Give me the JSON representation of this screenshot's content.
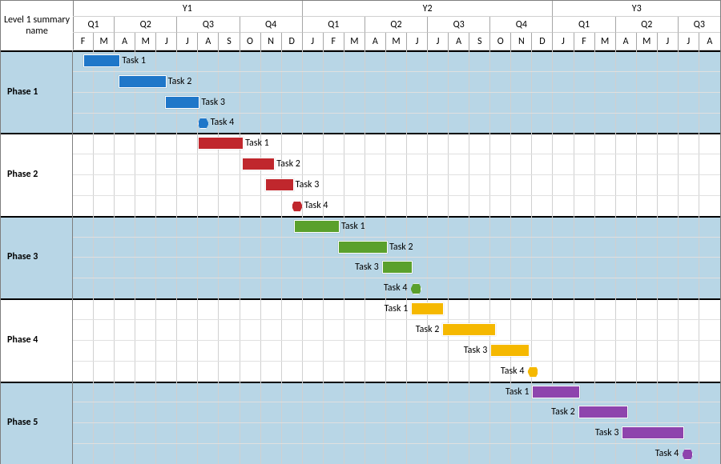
{
  "header": {
    "corner": "Level 1 summary name",
    "years": [
      "Y1",
      "Y2",
      "Y3"
    ],
    "quarters": [
      "Q1",
      "Q2",
      "Q3",
      "Q4",
      "Q1",
      "Q2",
      "Q3",
      "Q4",
      "Q1",
      "Q2",
      "Q3"
    ],
    "months": [
      "F",
      "M",
      "A",
      "M",
      "J",
      "J",
      "A",
      "S",
      "O",
      "N",
      "D",
      "J",
      "F",
      "M",
      "A",
      "M",
      "J",
      "J",
      "A",
      "S",
      "O",
      "N",
      "D",
      "J",
      "F",
      "M",
      "A",
      "M",
      "J",
      "J",
      "A"
    ]
  },
  "phases": [
    {
      "name": "Phase 1",
      "shaded": true,
      "color": "blue",
      "tasks": [
        {
          "label": "Task 1",
          "start_m": 0.5,
          "end_m": 2.2,
          "labelSide": "right"
        },
        {
          "label": "Task 2",
          "start_m": 2.2,
          "end_m": 4.4,
          "labelSide": "right"
        },
        {
          "label": "Task 3",
          "start_m": 4.4,
          "end_m": 6.0,
          "labelSide": "right"
        },
        {
          "label": "Task 4",
          "start_m": 6.2,
          "milestone": true,
          "labelSide": "right"
        }
      ]
    },
    {
      "name": "Phase 2",
      "shaded": false,
      "color": "red",
      "tasks": [
        {
          "label": "Task 1",
          "start_m": 6.0,
          "end_m": 8.1,
          "labelSide": "right"
        },
        {
          "label": "Task 2",
          "start_m": 8.1,
          "end_m": 9.6,
          "labelSide": "right"
        },
        {
          "label": "Task 3",
          "start_m": 9.2,
          "end_m": 10.5,
          "labelSide": "right"
        },
        {
          "label": "Task 4",
          "start_m": 10.7,
          "milestone": true,
          "labelSide": "right"
        }
      ]
    },
    {
      "name": "Phase 3",
      "shaded": true,
      "color": "green",
      "tasks": [
        {
          "label": "Task 1",
          "start_m": 10.6,
          "end_m": 12.7,
          "labelSide": "right"
        },
        {
          "label": "Task 2",
          "start_m": 12.7,
          "end_m": 15.0,
          "labelSide": "right"
        },
        {
          "label": "Task 3",
          "start_m": 14.8,
          "end_m": 16.2,
          "labelSide": "left"
        },
        {
          "label": "Task 4",
          "start_m": 16.4,
          "milestone": true,
          "labelSide": "left"
        }
      ]
    },
    {
      "name": "Phase 4",
      "shaded": false,
      "color": "yellow",
      "tasks": [
        {
          "label": "Task 1",
          "start_m": 16.2,
          "end_m": 17.7,
          "labelSide": "left"
        },
        {
          "label": "Task 2",
          "start_m": 17.7,
          "end_m": 20.2,
          "labelSide": "left"
        },
        {
          "label": "Task 3",
          "start_m": 20.0,
          "end_m": 21.8,
          "labelSide": "left"
        },
        {
          "label": "Task 4",
          "start_m": 22.0,
          "milestone": true,
          "labelSide": "left"
        }
      ]
    },
    {
      "name": "Phase 5",
      "shaded": true,
      "color": "purple",
      "tasks": [
        {
          "label": "Task 1",
          "start_m": 22.0,
          "end_m": 24.2,
          "labelSide": "left"
        },
        {
          "label": "Task 2",
          "start_m": 24.2,
          "end_m": 26.5,
          "labelSide": "left"
        },
        {
          "label": "Task 3",
          "start_m": 26.3,
          "end_m": 29.2,
          "labelSide": "left"
        },
        {
          "label": "Task 4",
          "start_m": 29.4,
          "milestone": true,
          "labelSide": "left"
        }
      ]
    }
  ],
  "chart_data": {
    "type": "bar",
    "title": "",
    "xlabel": "",
    "ylabel": "",
    "timeline": {
      "start": "Y1 Feb",
      "end": "Y3 Aug",
      "total_months": 31,
      "month_labels": [
        "F",
        "M",
        "A",
        "M",
        "J",
        "J",
        "A",
        "S",
        "O",
        "N",
        "D",
        "J",
        "F",
        "M",
        "A",
        "M",
        "J",
        "J",
        "A",
        "S",
        "O",
        "N",
        "D",
        "J",
        "F",
        "M",
        "A",
        "M",
        "J",
        "J",
        "A"
      ]
    },
    "series": [
      {
        "name": "Phase 1",
        "color": "#1f77c9",
        "tasks": [
          {
            "name": "Task 1",
            "start_month": 0.5,
            "end_month": 2.2
          },
          {
            "name": "Task 2",
            "start_month": 2.2,
            "end_month": 4.4
          },
          {
            "name": "Task 3",
            "start_month": 4.4,
            "end_month": 6.0
          },
          {
            "name": "Task 4",
            "milestone_month": 6.2
          }
        ]
      },
      {
        "name": "Phase 2",
        "color": "#c0272d",
        "tasks": [
          {
            "name": "Task 1",
            "start_month": 6.0,
            "end_month": 8.1
          },
          {
            "name": "Task 2",
            "start_month": 8.1,
            "end_month": 9.6
          },
          {
            "name": "Task 3",
            "start_month": 9.2,
            "end_month": 10.5
          },
          {
            "name": "Task 4",
            "milestone_month": 10.7
          }
        ]
      },
      {
        "name": "Phase 3",
        "color": "#5aa02c",
        "tasks": [
          {
            "name": "Task 1",
            "start_month": 10.6,
            "end_month": 12.7
          },
          {
            "name": "Task 2",
            "start_month": 12.7,
            "end_month": 15.0
          },
          {
            "name": "Task 3",
            "start_month": 14.8,
            "end_month": 16.2
          },
          {
            "name": "Task 4",
            "milestone_month": 16.4
          }
        ]
      },
      {
        "name": "Phase 4",
        "color": "#f5b800",
        "tasks": [
          {
            "name": "Task 1",
            "start_month": 16.2,
            "end_month": 17.7
          },
          {
            "name": "Task 2",
            "start_month": 17.7,
            "end_month": 20.2
          },
          {
            "name": "Task 3",
            "start_month": 20.0,
            "end_month": 21.8
          },
          {
            "name": "Task 4",
            "milestone_month": 22.0
          }
        ]
      },
      {
        "name": "Phase 5",
        "color": "#8e44ad",
        "tasks": [
          {
            "name": "Task 1",
            "start_month": 22.0,
            "end_month": 24.2
          },
          {
            "name": "Task 2",
            "start_month": 24.2,
            "end_month": 26.5
          },
          {
            "name": "Task 3",
            "start_month": 26.3,
            "end_month": 29.2
          },
          {
            "name": "Task 4",
            "milestone_month": 29.4
          }
        ]
      }
    ]
  }
}
